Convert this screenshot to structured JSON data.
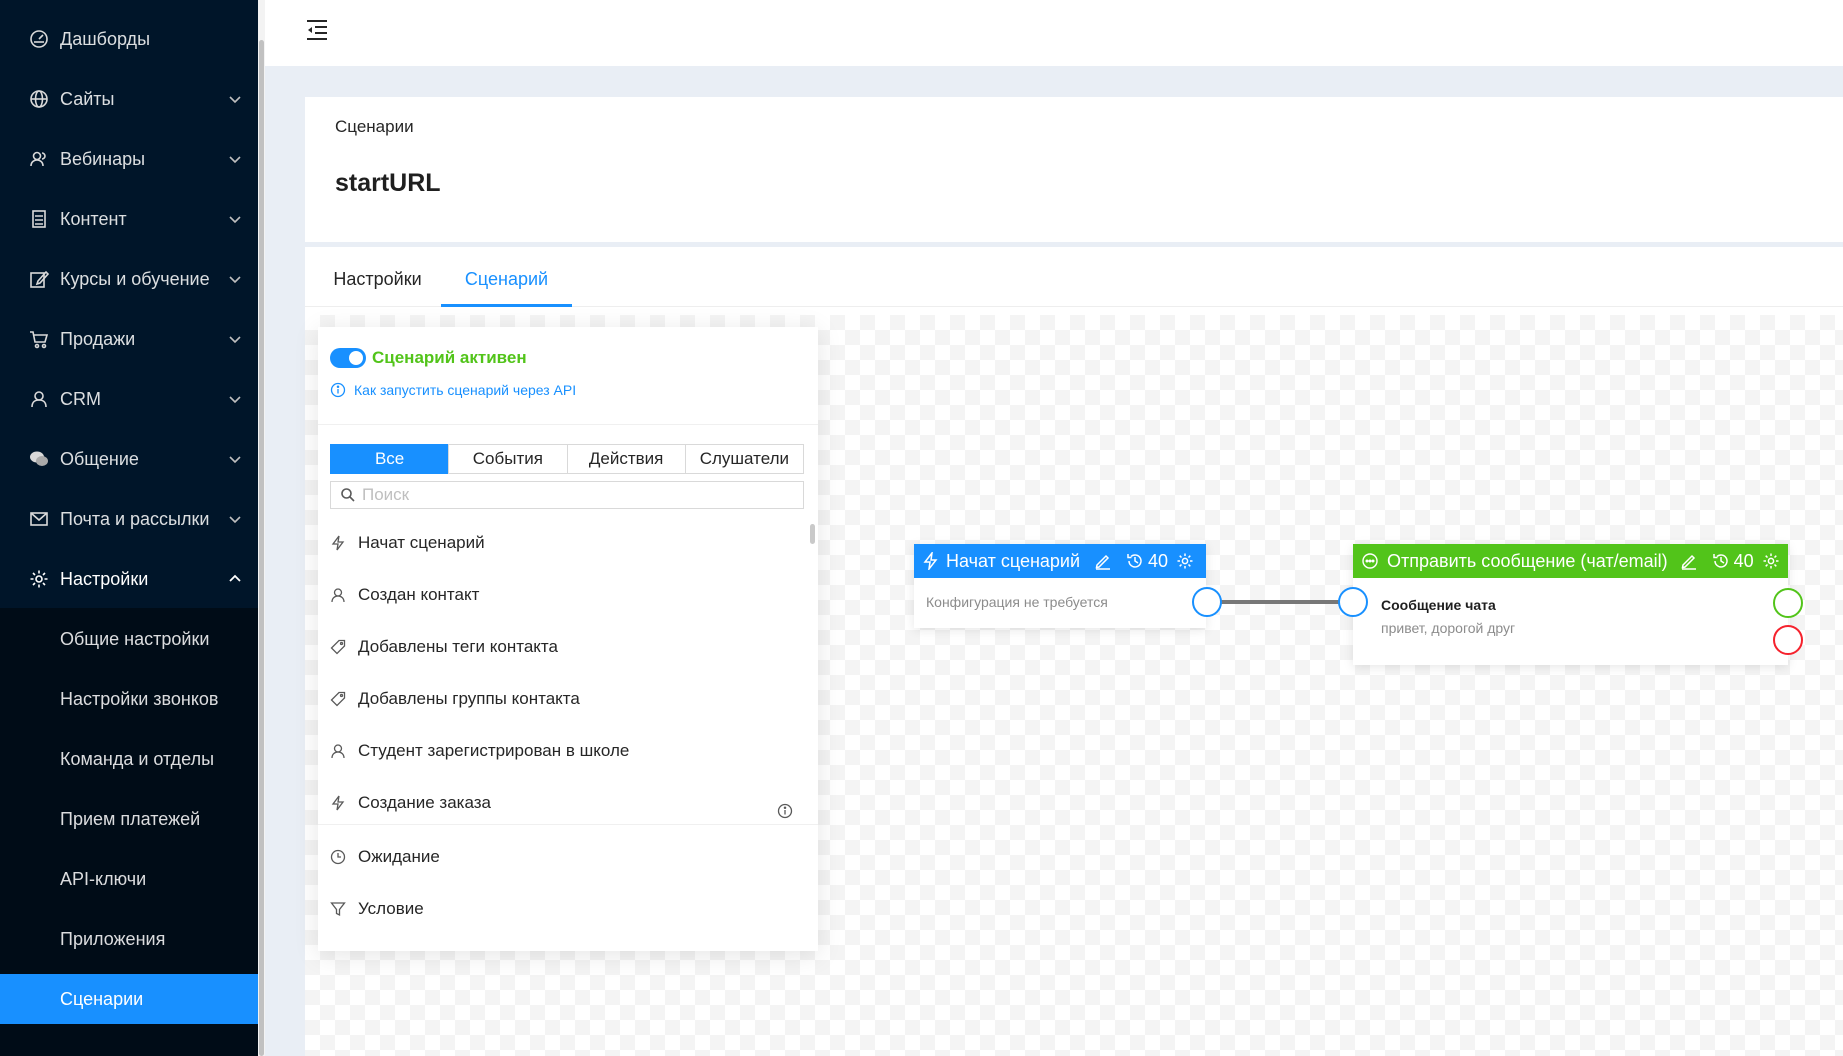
{
  "sidebar": {
    "items": [
      {
        "label": "Дашборды",
        "icon": "dashboard-icon"
      },
      {
        "label": "Сайты",
        "icon": "globe-icon"
      },
      {
        "label": "Вебинары",
        "icon": "users-icon"
      },
      {
        "label": "Контент",
        "icon": "content-icon"
      },
      {
        "label": "Курсы и обучение",
        "icon": "edit-icon"
      },
      {
        "label": "Продажи",
        "icon": "cart-icon"
      },
      {
        "label": "CRM",
        "icon": "user-icon"
      },
      {
        "label": "Общение",
        "icon": "chat-icon"
      },
      {
        "label": "Почта и рассылки",
        "icon": "mail-icon"
      },
      {
        "label": "Настройки",
        "icon": "gear-icon"
      }
    ],
    "sub_items": [
      {
        "label": "Общие настройки"
      },
      {
        "label": "Настройки звонков"
      },
      {
        "label": "Команда и отделы"
      },
      {
        "label": "Прием платежей"
      },
      {
        "label": "API-ключи"
      },
      {
        "label": "Приложения"
      },
      {
        "label": "Сценарии"
      }
    ]
  },
  "page": {
    "breadcrumb": "Сценарии",
    "title": "startURL"
  },
  "tabs": [
    {
      "label": "Настройки"
    },
    {
      "label": "Сценарий"
    }
  ],
  "palette": {
    "active_label": "Сценарий активен",
    "api_link": "Как запустить сценарий через API",
    "filters": [
      "Все",
      "События",
      "Действия",
      "Слушатели"
    ],
    "search_placeholder": "Поиск",
    "items": [
      {
        "label": "Начат сценарий",
        "icon": "bolt-icon"
      },
      {
        "label": "Создан контакт",
        "icon": "user-icon"
      },
      {
        "label": "Добавлены теги контакта",
        "icon": "tag-icon"
      },
      {
        "label": "Добавлены группы контакта",
        "icon": "tag-icon"
      },
      {
        "label": "Студент зарегистрирован в школе",
        "icon": "user-icon"
      },
      {
        "label": "Создание заказа",
        "icon": "bolt-icon"
      }
    ],
    "bottom_items": [
      {
        "label": "Ожидание",
        "icon": "clock-icon"
      },
      {
        "label": "Условие",
        "icon": "filter-icon"
      }
    ]
  },
  "nodes": {
    "start": {
      "title": "Начат сценарий",
      "count": "40",
      "body": "Конфигурация не требуется",
      "color": "#1890ff"
    },
    "message": {
      "title": "Отправить сообщение (чат/email)",
      "count": "40",
      "body_title": "Сообщение чата",
      "body_text": "привет, дорогой друг",
      "color": "#52c41a"
    }
  },
  "colors": {
    "sidebar_bg": "#001529",
    "accent": "#1890ff",
    "success": "#52c41a",
    "danger": "#f5222d"
  }
}
